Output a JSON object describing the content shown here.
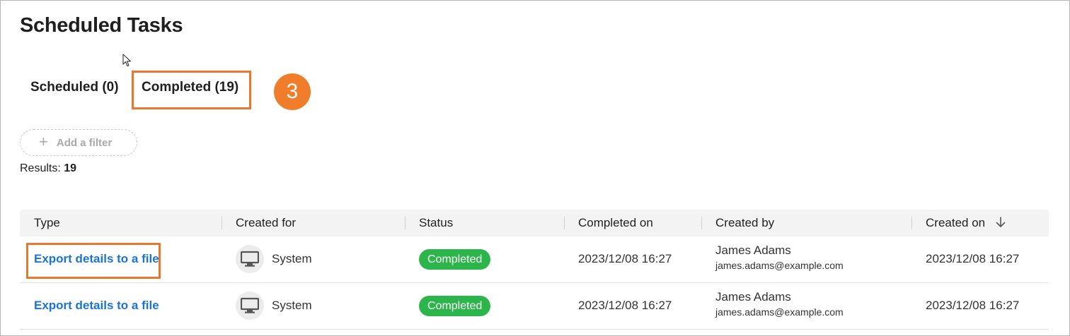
{
  "page": {
    "title": "Scheduled Tasks"
  },
  "tabs": [
    {
      "label": "Scheduled (0)"
    },
    {
      "label": "Completed (19)"
    }
  ],
  "callout": {
    "number": "3",
    "color": "#f07d2a"
  },
  "filter": {
    "add_label": "Add a filter"
  },
  "results": {
    "label": "Results:",
    "count": "19"
  },
  "table": {
    "headers": {
      "type": "Type",
      "created_for": "Created for",
      "status": "Status",
      "completed_on": "Completed on",
      "created_by": "Created by",
      "created_on": "Created on"
    },
    "rows": [
      {
        "type": "Export details to a file",
        "created_for": "System",
        "status": "Completed",
        "completed_on": "2023/12/08 16:27",
        "created_by_name": "James Adams",
        "created_by_email": "james.adams@example.com",
        "created_on": "2023/12/08 16:27"
      },
      {
        "type": "Export details to a file",
        "created_for": "System",
        "status": "Completed",
        "completed_on": "2023/12/08 16:27",
        "created_by_name": "James Adams",
        "created_by_email": "james.adams@example.com",
        "created_on": "2023/12/08 16:27"
      }
    ]
  },
  "colors": {
    "link": "#1a73d9",
    "status_completed": "#2bb54a",
    "highlight": "#e8782e"
  }
}
